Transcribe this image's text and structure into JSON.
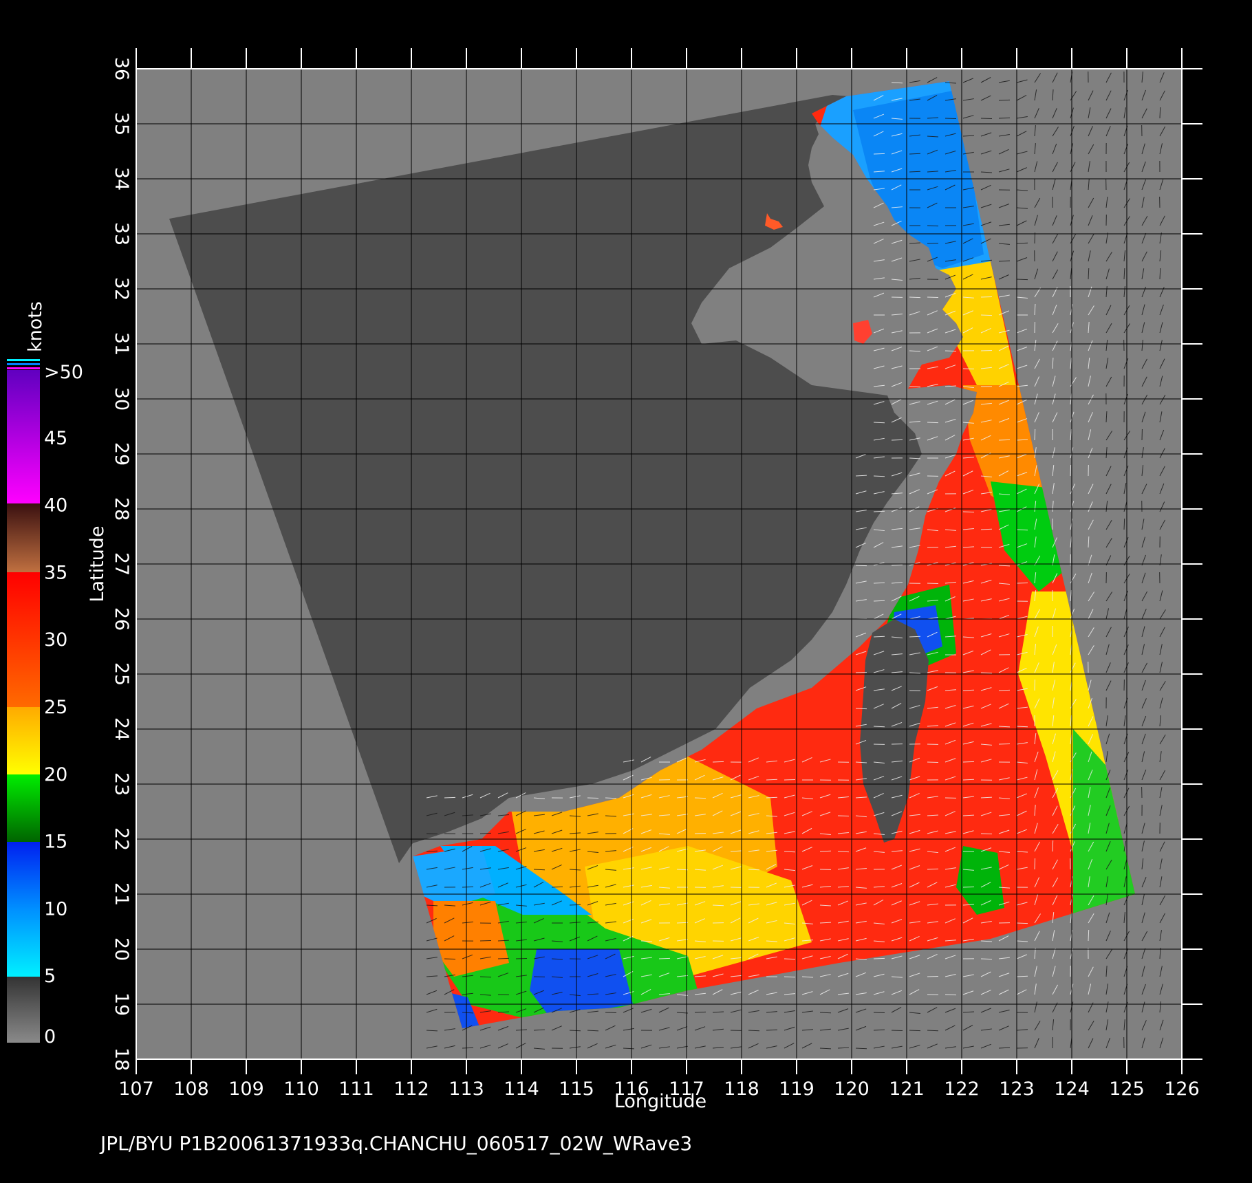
{
  "map": {
    "footer": "JPL/BYU  P1B20061371933q.CHANCHU_060517_02W_WRave3",
    "x_axis_label": "Longitude",
    "y_axis_label": "Latitude",
    "lon_ticks": [
      "107",
      "108",
      "109",
      "110",
      "111",
      "112",
      "113",
      "114",
      "115",
      "116",
      "117",
      "118",
      "119",
      "120",
      "121",
      "122",
      "123",
      "124",
      "125",
      "126"
    ],
    "lat_ticks": [
      "18",
      "19",
      "20",
      "21",
      "22",
      "23",
      "24",
      "25",
      "26",
      "27",
      "28",
      "29",
      "30",
      "31",
      "32",
      "33",
      "34",
      "35",
      "36"
    ],
    "lon_range": [
      107,
      126
    ],
    "lat_range": [
      18,
      36
    ],
    "background_color": "#000000",
    "land_color": "#808080",
    "no_data_color": "#4d4d4d"
  },
  "legend": {
    "title": "knots",
    "labels": [
      ">50",
      "45",
      "40",
      "35",
      "30",
      "25",
      "20",
      "15",
      "10",
      "5",
      "0"
    ],
    "scale": [
      {
        "from": 0,
        "to": 5,
        "color_low": "#8a8a8a",
        "color_high": "#333333"
      },
      {
        "from": 5,
        "to": 15,
        "color_low": "#00f0ff",
        "color_high": "#0020f0"
      },
      {
        "from": 15,
        "to": 20,
        "color_low": "#006400",
        "color_high": "#00ee00"
      },
      {
        "from": 20,
        "to": 25,
        "color_low": "#ffff00",
        "color_high": "#ffaa00"
      },
      {
        "from": 25,
        "to": 35,
        "color_low": "#ff6a00",
        "color_high": "#ff0000"
      },
      {
        "from": 35,
        "to": 40,
        "color_low": "#c07040",
        "color_high": "#3a1010"
      },
      {
        "from": 40,
        "to": 50,
        "color_low": "#ff00ff",
        "color_high": "#6000c0"
      }
    ]
  }
}
